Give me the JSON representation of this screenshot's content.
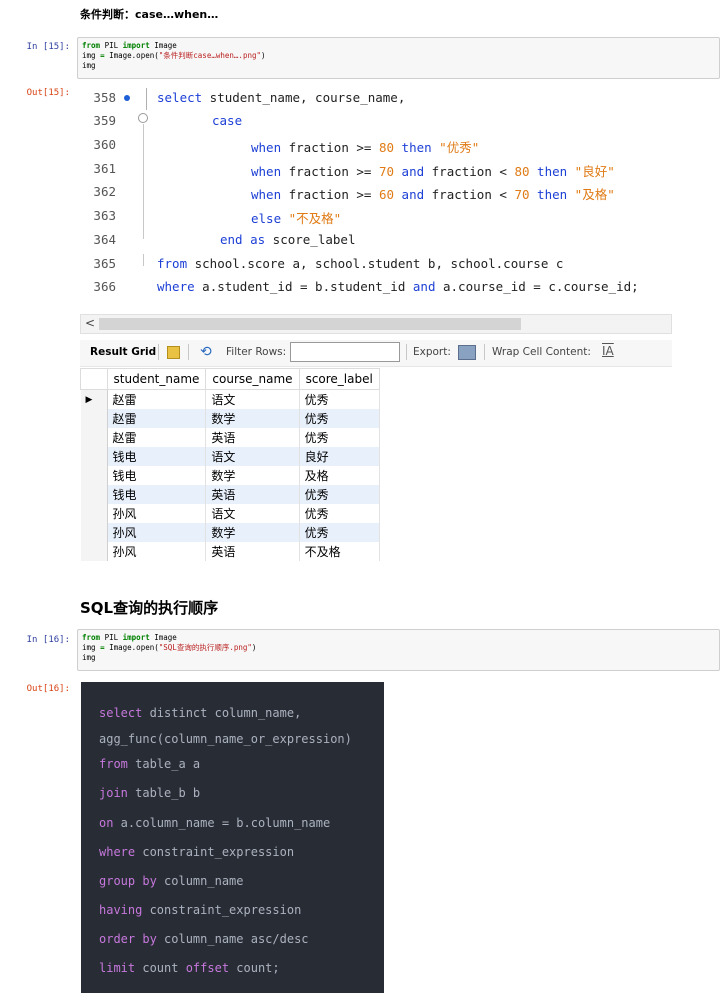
{
  "heading_case": "条件判断：case…when…",
  "heading_order": "SQL查询的执行顺序",
  "cells": [
    {
      "in_prompt": "In  [15]:",
      "out_prompt": "Out[15]:",
      "code": {
        "line1_kw1": "from",
        "line1_mod": " PIL ",
        "line1_kw2": "import",
        "line1_name": " Image",
        "line2_pre": "img ",
        "line2_eq": "=",
        "line2_call": " Image.open(",
        "line2_str": "\"条件判断case…when….png\"",
        "line2_close": ")",
        "line3": "img"
      }
    },
    {
      "in_prompt": "In  [16]:",
      "out_prompt": "Out[16]:",
      "code": {
        "line1_kw1": "from",
        "line1_mod": " PIL ",
        "line1_kw2": "import",
        "line1_name": " Image",
        "line2_pre": "img ",
        "line2_eq": "=",
        "line2_call": " Image.open(",
        "line2_str": "\"SQL查询的执行顺序.png\"",
        "line2_close": ")",
        "line3": "img"
      }
    }
  ],
  "sql_screenshot": {
    "line_numbers": [
      "358",
      "359",
      "360",
      "361",
      "362",
      "363",
      "364",
      "365",
      "366"
    ],
    "lines": {
      "l358": {
        "kw": "select",
        "rest": " student_name, course_name,"
      },
      "l359": {
        "kw": "case"
      },
      "l360": {
        "kw1": "when",
        "id": " fraction >= ",
        "num": "80",
        "kw2": " then ",
        "str": "\"优秀\""
      },
      "l361": {
        "kw1": "when",
        "id1": " fraction >= ",
        "num1": "70",
        "kw2": " and ",
        "id2": "fraction < ",
        "num2": "80",
        "kw3": " then ",
        "str": "\"良好\""
      },
      "l362": {
        "kw1": "when",
        "id1": " fraction >= ",
        "num1": "60",
        "kw2": " and ",
        "id2": "fraction < ",
        "num2": "70",
        "kw3": " then ",
        "str": "\"及格\""
      },
      "l363": {
        "kw": "else",
        "str": " \"不及格\""
      },
      "l364": {
        "kw1": "end",
        "kw2": " as",
        "rest": " score_label"
      },
      "l365": {
        "kw": "from",
        "rest": " school.score a, school.student b, school.course c"
      },
      "l366": {
        "kw1": "where",
        "rest1": " a.student_id = b.student_id ",
        "kw2": "and",
        "rest2": " a.course_id = c.course_id;"
      }
    },
    "scroll_arrow": "<",
    "toolbar": {
      "result_grid": "Result Grid",
      "filter_rows": "Filter Rows:",
      "filter_value": "",
      "export": "Export:",
      "wrap": "Wrap Cell Content:"
    },
    "grid": {
      "columns": [
        "student_name",
        "course_name",
        "score_label"
      ],
      "rows": [
        [
          "赵雷",
          "语文",
          "优秀"
        ],
        [
          "赵雷",
          "数学",
          "优秀"
        ],
        [
          "赵雷",
          "英语",
          "优秀"
        ],
        [
          "钱电",
          "语文",
          "良好"
        ],
        [
          "钱电",
          "数学",
          "及格"
        ],
        [
          "钱电",
          "英语",
          "优秀"
        ],
        [
          "孙风",
          "语文",
          "优秀"
        ],
        [
          "孙风",
          "数学",
          "优秀"
        ],
        [
          "孙风",
          "英语",
          "不及格"
        ]
      ]
    }
  },
  "order_screenshot": {
    "lines": [
      {
        "kw": "select",
        "txt": " distinct column_name,"
      },
      {
        "kw": "",
        "txt": "agg_func(column_name_or_expression)"
      },
      {
        "kw": "from",
        "txt": " table_a a"
      },
      {
        "kw": "join",
        "txt": " table_b b"
      },
      {
        "kw": "on",
        "txt": " a.column_name = b.column_name"
      },
      {
        "kw": "where",
        "txt": " constraint_expression"
      },
      {
        "kw": "group by",
        "txt": " column_name"
      },
      {
        "kw": "having",
        "txt": " constraint_expression"
      },
      {
        "kw": "order by",
        "txt": " column_name asc/desc"
      },
      {
        "kw": "limit",
        "txt": " count ",
        "kw2": "offset",
        "txt2": " count;"
      }
    ]
  }
}
